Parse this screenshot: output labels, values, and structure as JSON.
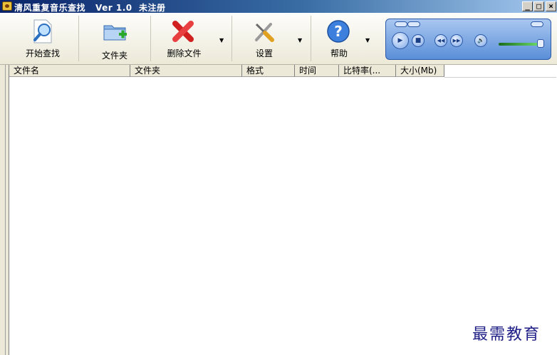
{
  "window": {
    "title": "清风重复音乐查找   Ver 1.0  未注册",
    "controls": {
      "minimize": "_",
      "maximize": "□",
      "close": "×"
    }
  },
  "toolbar": {
    "buttons": [
      {
        "label": "开始查找",
        "icon": "search-icon",
        "has_dropdown": false
      },
      {
        "label": "文件夹",
        "icon": "folder-add-icon",
        "has_dropdown": false
      },
      {
        "label": "删除文件",
        "icon": "delete-x-icon",
        "has_dropdown": true
      },
      {
        "label": "设置",
        "icon": "tools-icon",
        "has_dropdown": true
      },
      {
        "label": "帮助",
        "icon": "help-icon",
        "has_dropdown": true
      }
    ],
    "dropdown_glyph": "▼"
  },
  "player": {
    "icons": [
      "play-icon",
      "stop-icon",
      "prev-icon",
      "next-icon",
      "mute-icon"
    ],
    "glyphs": {
      "play": "▶",
      "stop": "■",
      "prev": "◀◀",
      "next": "▶▶",
      "mute": "🔊"
    }
  },
  "file_list": {
    "columns": [
      "文件名",
      "文件夹",
      "格式",
      "时间",
      "比特率(...",
      "大小(Mb)"
    ],
    "rows": []
  },
  "watermark": "最需教育",
  "colors": {
    "titlebar": "#0a246a",
    "toolbar": "#ece9d8",
    "list_bg": "#ffffff",
    "watermark": "#1f1f88"
  }
}
